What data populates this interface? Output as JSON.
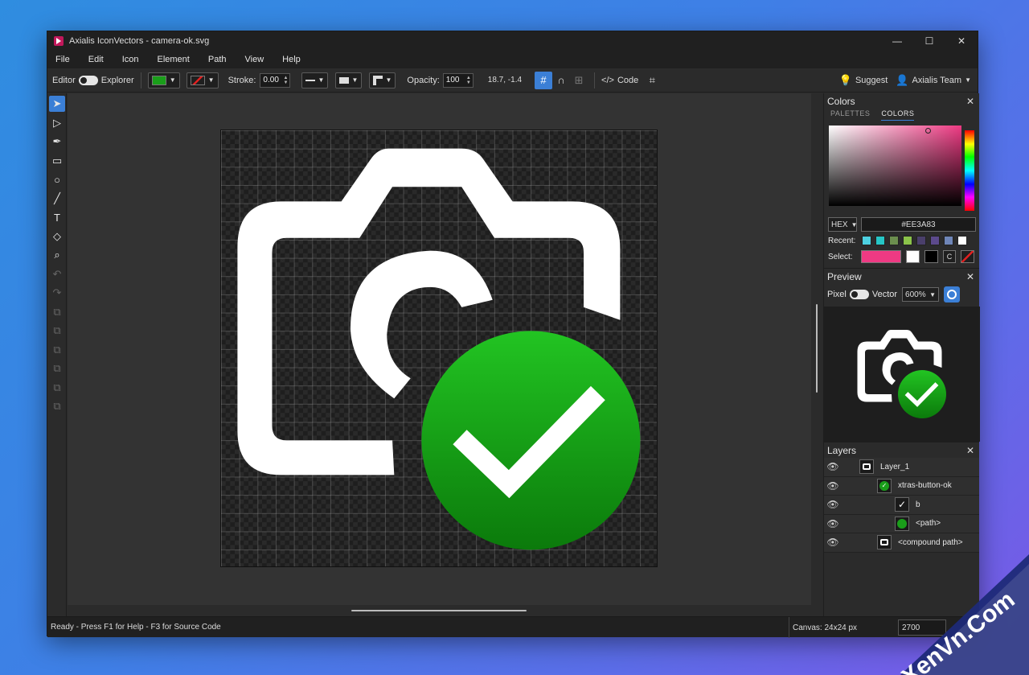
{
  "window": {
    "title": "Axialis IconVectors - camera-ok.svg",
    "minimize_icon": "minimize-icon",
    "maximize_icon": "maximize-icon",
    "close_icon": "close-icon"
  },
  "menu": [
    "File",
    "Edit",
    "Icon",
    "Element",
    "Path",
    "View",
    "Help"
  ],
  "toolbar": {
    "editor_label": "Editor",
    "explorer_label": "Explorer",
    "fill_color": "#1a9e1a",
    "stroke_color_icon": "red-slash",
    "stroke_label": "Stroke:",
    "stroke_value": "0.00",
    "opacity_label": "Opacity:",
    "opacity_value": "100",
    "coords": "18.7, -1.4",
    "code_label": "Code",
    "suggest_label": "Suggest",
    "account_label": "Axialis Team"
  },
  "colors_panel": {
    "title": "Colors",
    "tabs": [
      "PALETTES",
      "COLORS"
    ],
    "active_tab": "COLORS",
    "mode": "HEX",
    "hex_value": "#EE3A83",
    "recent_label": "Recent:",
    "recent": [
      "#4dd0e1",
      "#26c6c6",
      "#6b8e4e",
      "#8bc34a",
      "#4a3f6b",
      "#5c4a8c",
      "#6f86b8",
      "#ffffff"
    ],
    "select_label": "Select:",
    "select_main": "#ee3a83"
  },
  "preview_panel": {
    "title": "Preview",
    "pixel_label": "Pixel",
    "vector_label": "Vector",
    "zoom": "600%"
  },
  "layers_panel": {
    "title": "Layers",
    "items": [
      {
        "name": "Layer_1"
      },
      {
        "name": "xtras-button-ok"
      },
      {
        "name": "b"
      },
      {
        "name": "<path>"
      },
      {
        "name": "<compound path>"
      }
    ]
  },
  "status": {
    "help": "Ready - Press F1 for Help - F3 for Source Code",
    "canvas": "Canvas: 24x24 px",
    "zoom": "2700"
  },
  "watermark": {
    "text": "XenVn.Com"
  }
}
